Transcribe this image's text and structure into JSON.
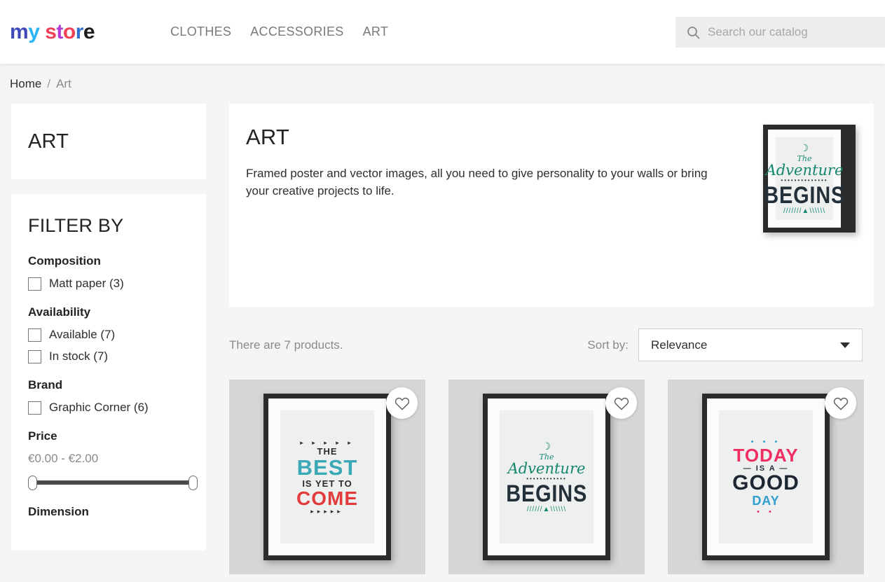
{
  "header": {
    "logo": {
      "letters": [
        {
          "ch": "m",
          "color": "#3f4ab8"
        },
        {
          "ch": "y",
          "color": "#29b6f6"
        },
        {
          "ch": " ",
          "color": "#ffffff"
        },
        {
          "ch": "s",
          "color": "#ef4056"
        },
        {
          "ch": "t",
          "color": "#b23bd6"
        },
        {
          "ch": "o",
          "color": "#ef4056"
        },
        {
          "ch": "r",
          "color": "#2f6fd0"
        },
        {
          "ch": "e",
          "color": "#1b1b1b"
        }
      ]
    },
    "nav": [
      {
        "label": "CLOTHES"
      },
      {
        "label": "ACCESSORIES"
      },
      {
        "label": "ART"
      }
    ],
    "search": {
      "placeholder": "Search our catalog",
      "value": "",
      "icon": "search-icon"
    }
  },
  "breadcrumb": {
    "home": "Home",
    "separator": "/",
    "current": "Art"
  },
  "sidebar": {
    "category_title": "ART",
    "filter_heading": "FILTER BY",
    "facets": [
      {
        "title": "Composition",
        "options": [
          {
            "label": "Matt paper (3)",
            "checked": false
          }
        ]
      },
      {
        "title": "Availability",
        "options": [
          {
            "label": "Available (7)",
            "checked": false
          },
          {
            "label": "In stock (7)",
            "checked": false
          }
        ]
      },
      {
        "title": "Brand",
        "options": [
          {
            "label": "Graphic Corner (6)",
            "checked": false
          }
        ]
      }
    ],
    "price": {
      "title": "Price",
      "range_text": "€0.00 - €2.00",
      "min": "€0.00",
      "max": "€2.00"
    },
    "dimension": {
      "title": "Dimension"
    }
  },
  "main": {
    "title": "ART",
    "description": "Framed poster and vector images, all you need to give personality to your walls or bring your creative projects to life.",
    "cover": {
      "name": "the-adventure-begins-poster",
      "line_script_small": "The",
      "line_script": "Adventure",
      "line_big": "BEGINS",
      "dots": "••••••••••••••",
      "moon": "☽",
      "tent": "///////▲\\\\\\\\\\\\"
    },
    "sortbar": {
      "product_count": "There are 7 products.",
      "sort_label": "Sort by:",
      "sort_value": "Relevance"
    },
    "products": [
      {
        "poster": "best",
        "wishlist_icon": "heart-icon",
        "lines": {
          "top_arrows": "▸ ▸ ▸ ▸ ▸",
          "the": "THE",
          "best": "BEST",
          "isyetto": "IS YET TO",
          "come": "COME",
          "bottom_arrows": "▸▸▸▸▸",
          "heart": "♥"
        }
      },
      {
        "poster": "adventure",
        "wishlist_icon": "heart-icon",
        "lines": {
          "moon": "☽",
          "the": "The",
          "adventure": "Adventure",
          "dots": "••••••••••••",
          "begins": "BEGINS",
          "tent": "//////▲\\\\\\\\\\\\"
        }
      },
      {
        "poster": "today",
        "wishlist_icon": "heart-icon",
        "lines": {
          "top_dots": "• • •",
          "today": "TODAY",
          "isa": "— IS A —",
          "good": "GOOD",
          "day": "DAY",
          "bottom_dots_left": "• •",
          "bottom_dots_right": "• •"
        }
      }
    ]
  },
  "colors": {
    "page_bg": "#f5f5f5",
    "panel_bg": "#ffffff",
    "text": "#2e2e2e",
    "muted": "#8a8a8a",
    "thumb_bg": "#d6d6d6",
    "slider_track": "#4a4a4a"
  }
}
